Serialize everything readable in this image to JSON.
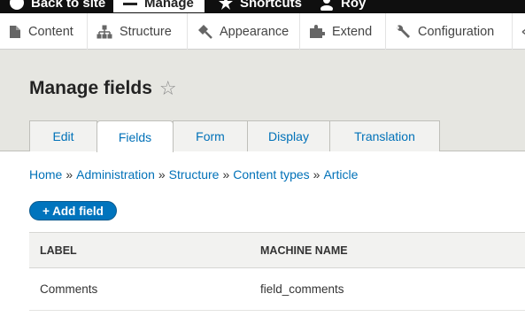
{
  "toolbar": {
    "back_to_site": "Back to site",
    "manage": "Manage",
    "shortcuts": "Shortcuts",
    "user": "Roy"
  },
  "tray": {
    "items": [
      {
        "label": "Content",
        "icon": "document-icon"
      },
      {
        "label": "Structure",
        "icon": "sitemap-icon"
      },
      {
        "label": "Appearance",
        "icon": "brush-icon"
      },
      {
        "label": "Extend",
        "icon": "puzzle-icon"
      },
      {
        "label": "Configuration",
        "icon": "wrench-icon"
      }
    ]
  },
  "page": {
    "title": "Manage fields",
    "star_glyph": "☆"
  },
  "tabs": [
    {
      "label": "Edit",
      "active": false
    },
    {
      "label": "Fields",
      "active": true
    },
    {
      "label": "Form",
      "active": false
    },
    {
      "label": "Display",
      "active": false
    },
    {
      "label": "Translation",
      "active": false
    }
  ],
  "breadcrumb": {
    "items": [
      "Home",
      "Administration",
      "Structure",
      "Content types",
      "Article"
    ],
    "separator": "»"
  },
  "actions": {
    "add_field": "+ Add field"
  },
  "table": {
    "headers": [
      "LABEL",
      "MACHINE NAME"
    ],
    "rows": [
      {
        "label": "Comments",
        "machine_name": "field_comments"
      }
    ]
  },
  "colors": {
    "toolbar_bg": "#0f0f0f",
    "header_bg": "#e6e6e1",
    "link": "#0071b8",
    "primary_button": "#0074bd"
  }
}
